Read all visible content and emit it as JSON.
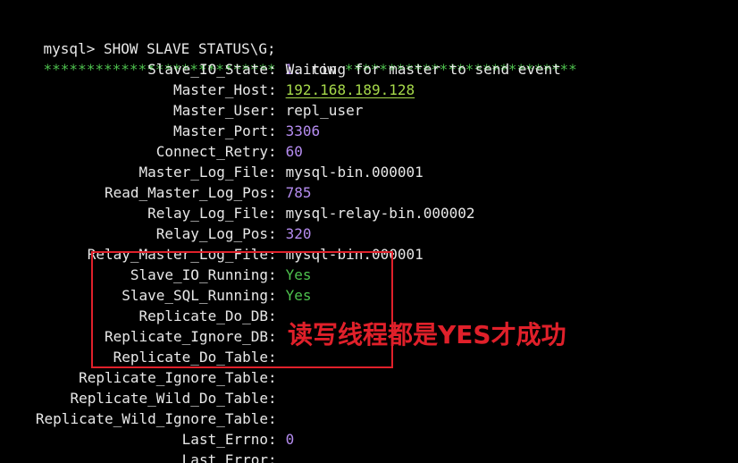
{
  "command": {
    "prompt": "mysql",
    "gt": ">",
    "text": " SHOW SLAVE STATUS\\G;"
  },
  "row_header": {
    "stars_left": "***************************",
    "row_num": " 1.",
    "row_word": " row ",
    "stars_right": "***************************"
  },
  "fields": [
    {
      "name": "Slave_IO_State",
      "value": "Waiting for master to send event",
      "kind": "text"
    },
    {
      "name": "Master_Host",
      "value": "192.168.189.128",
      "kind": "ip"
    },
    {
      "name": "Master_User",
      "value": "repl_user",
      "kind": "text"
    },
    {
      "name": "Master_Port",
      "value": "3306",
      "kind": "num"
    },
    {
      "name": "Connect_Retry",
      "value": "60",
      "kind": "num"
    },
    {
      "name": "Master_Log_File",
      "value": "mysql-bin.000001",
      "kind": "text"
    },
    {
      "name": "Read_Master_Log_Pos",
      "value": "785",
      "kind": "num"
    },
    {
      "name": "Relay_Log_File",
      "value": "mysql-relay-bin.000002",
      "kind": "text"
    },
    {
      "name": "Relay_Log_Pos",
      "value": "320",
      "kind": "num"
    },
    {
      "name": "Relay_Master_Log_File",
      "value": "mysql-bin.000001",
      "kind": "text"
    },
    {
      "name": "Slave_IO_Running",
      "value": "Yes",
      "kind": "yes"
    },
    {
      "name": "Slave_SQL_Running",
      "value": "Yes",
      "kind": "yes"
    },
    {
      "name": "Replicate_Do_DB",
      "value": "",
      "kind": "text"
    },
    {
      "name": "Replicate_Ignore_DB",
      "value": "",
      "kind": "text"
    },
    {
      "name": "Replicate_Do_Table",
      "value": "",
      "kind": "text"
    },
    {
      "name": "Replicate_Ignore_Table",
      "value": "",
      "kind": "text"
    },
    {
      "name": "Replicate_Wild_Do_Table",
      "value": "",
      "kind": "text"
    },
    {
      "name": "Replicate_Wild_Ignore_Table",
      "value": "",
      "kind": "text"
    },
    {
      "name": "Last_Errno",
      "value": "0",
      "kind": "num"
    },
    {
      "name": "Last_Error",
      "value": "",
      "kind": "text"
    }
  ],
  "annotation": "读写线程都是YES才成功",
  "colors": {
    "background": "#000000",
    "text": "#e8e8e8",
    "stars": "#4ec24e",
    "number": "#b58cf0",
    "ip": "#a6d94a",
    "yes": "#4ec24e",
    "annotation": "#e0202a"
  }
}
